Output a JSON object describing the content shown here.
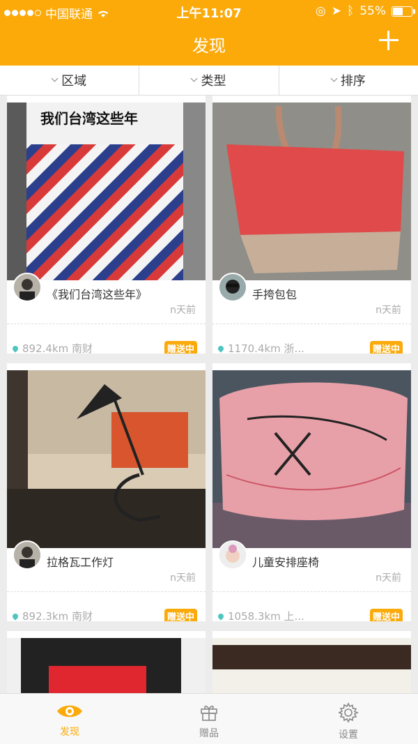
{
  "status": {
    "carrier": "中国联通",
    "time": "上午11:07",
    "battery": "55%",
    "battery_level": 0.55
  },
  "header": {
    "title": "发现",
    "add_icon": "plus-icon"
  },
  "filters": [
    {
      "label": "区域"
    },
    {
      "label": "类型"
    },
    {
      "label": "排序"
    }
  ],
  "items": [
    {
      "title": "《我们台湾这些年》",
      "time": "n天前",
      "location": "892.4km 南财",
      "badge": "赠送中",
      "cover_text": "我们台湾这些年"
    },
    {
      "title": "手挎包包",
      "time": "n天前",
      "location": "1170.4km 浙...",
      "badge": "赠送中"
    },
    {
      "title": "拉格瓦工作灯",
      "time": "n天前",
      "location": "892.3km 南财",
      "badge": "赠送中"
    },
    {
      "title": "儿童安排座椅",
      "time": "n天前",
      "location": "1058.3km 上...",
      "badge": "赠送中"
    }
  ],
  "tabs": [
    {
      "label": "发现",
      "icon": "eye-icon"
    },
    {
      "label": "赠品",
      "icon": "gift-icon"
    },
    {
      "label": "设置",
      "icon": "gear-icon"
    }
  ],
  "colors": {
    "accent": "#fbaa0a",
    "pin": "#4ec5c0"
  }
}
